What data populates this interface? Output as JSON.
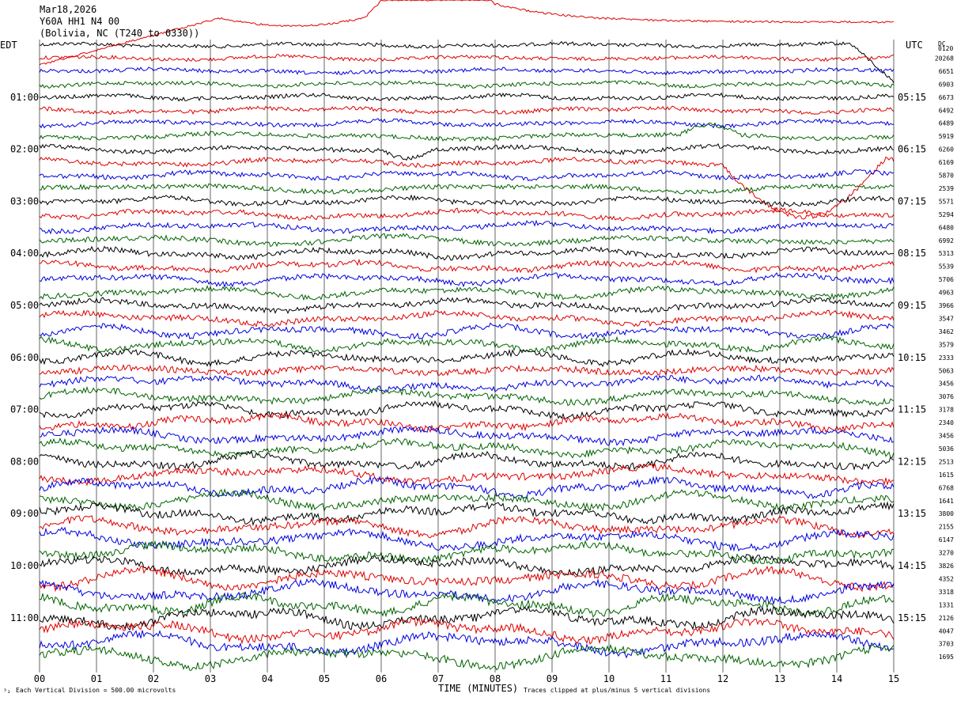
{
  "header": {
    "date": "Mar18,2026",
    "station": "Y60A HH1 N4 00",
    "location": "(Bolivia, NC (T240 to 0330))"
  },
  "left_axis_title": "EDT",
  "right_axis_title": "UTC",
  "dc_title": "DC",
  "dc_title2": "0120",
  "edt_labels": [
    "01:00",
    "02:00",
    "03:00",
    "04:00",
    "05:00",
    "06:00",
    "07:00",
    "08:00",
    "09:00",
    "10:00",
    "11:00"
  ],
  "utc_labels": [
    "05:15",
    "06:15",
    "07:15",
    "08:15",
    "09:15",
    "10:15",
    "11:15",
    "12:15",
    "13:15",
    "14:15",
    "15:15"
  ],
  "dc_values": [
    "20268",
    "6651",
    "6903",
    "6673",
    "6492",
    "6489",
    "5919",
    "6260",
    "6169",
    "5870",
    "2539",
    "5571",
    "5294",
    "6480",
    "6992",
    "5313",
    "5539",
    "5706",
    "4963",
    "3966",
    "3547",
    "3462",
    "3579",
    "2333",
    "5063",
    "3456",
    "3076",
    "3178",
    "2340",
    "3456",
    "5036",
    "2513",
    "1615",
    "6768",
    "1641",
    "3800",
    "2155",
    "6147",
    "3270",
    "3826",
    "4352",
    "3318",
    "1331",
    "2126",
    "4047",
    "3703",
    "1695"
  ],
  "x_ticks": [
    "00",
    "01",
    "02",
    "03",
    "04",
    "05",
    "06",
    "07",
    "08",
    "09",
    "10",
    "11",
    "12",
    "13",
    "14",
    "15"
  ],
  "x_axis_label": "TIME (MINUTES)",
  "footer_left": "Each Vertical Division =  500.00 microvolts",
  "footer_right": "Traces clipped at plus/minus 5 vertical divisions",
  "footer_corner": "³₂",
  "colors": {
    "cycle": [
      "#000000",
      "#e00000",
      "#0000e0",
      "#006400"
    ],
    "grid": "#000000"
  },
  "chart_data": {
    "type": "line",
    "title": "Mar18,2026",
    "xlabel": "TIME (MINUTES)",
    "ylabel": "EDT",
    "xlim": [
      0,
      15
    ],
    "trace_count": 48,
    "color_cycle": [
      "black",
      "red",
      "blue",
      "green"
    ],
    "hour_labels_edt": [
      "01:00",
      "02:00",
      "03:00",
      "04:00",
      "05:00",
      "06:00",
      "07:00",
      "08:00",
      "09:00",
      "10:00",
      "11:00"
    ],
    "hour_labels_utc": [
      "05:15",
      "06:15",
      "07:15",
      "08:15",
      "09:15",
      "10:15",
      "11:15",
      "12:15",
      "13:15",
      "14:15",
      "15:15"
    ],
    "vertical_division_microvolts": 500.0,
    "clip_divisions": 5
  }
}
